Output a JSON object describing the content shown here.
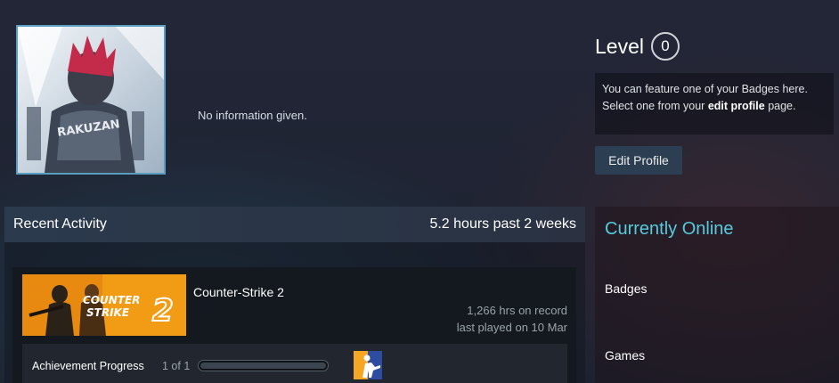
{
  "profile": {
    "summary": "No information given.",
    "level_label": "Level",
    "level_value": "0",
    "badge_notice": {
      "line1": "You can feature one of your Badges here.",
      "line2_prefix": "Select one from your ",
      "line2_link": "edit profile",
      "line2_suffix": " page."
    },
    "edit_button": "Edit Profile",
    "avatar_text": "RAKUZAN"
  },
  "recent_activity": {
    "title": "Recent Activity",
    "hours": "5.2 hours past 2 weeks",
    "games": [
      {
        "name": "Counter-Strike 2",
        "capsule_line1": "COUNTER",
        "capsule_line2": "STRIKE",
        "capsule_number": "2",
        "hours_on_record": "1,266 hrs on record",
        "last_played": "last played on 10 Mar",
        "achievement_label": "Achievement Progress",
        "achievement_count": "1 of 1",
        "achievement_progress": 1.0
      }
    ]
  },
  "sidebar": {
    "online_status": "Currently Online",
    "nav_badges": "Badges",
    "nav_games": "Games"
  },
  "colors": {
    "online_accent": "#57cbde",
    "capsule_orange": "#f29b14",
    "avatar_border": "#5b9dc0"
  }
}
